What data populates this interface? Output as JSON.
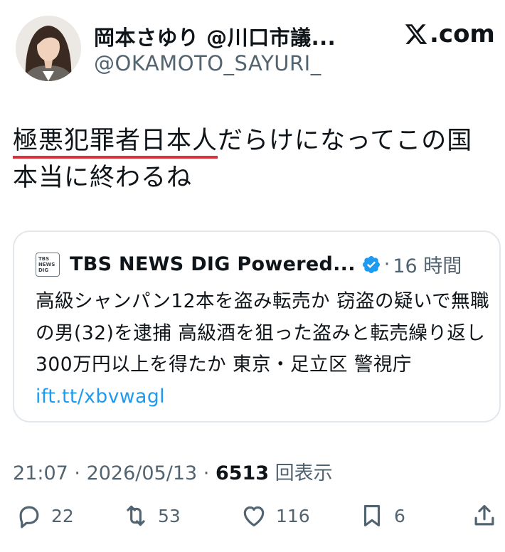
{
  "header": {
    "display_name": "岡本さゆり @川口市議...",
    "handle": "@OKAMOTO_SAYURI_",
    "site_label": ".com"
  },
  "post": {
    "text_underlined": "極悪犯罪者日本人",
    "text_rest": "だらけになってこの国本当に終わるね",
    "underline_color": "#d8323c"
  },
  "quote": {
    "source_logo_lines": [
      "TBS",
      "NEWS",
      "DIG"
    ],
    "source_name": "TBS NEWS DIG Powered...",
    "separator": "·",
    "time": "16 時間",
    "body": "高級シャンパン12本を盗み転売か 窃盗の疑いで無職の男(32)を逮捕 高級酒を狙った盗みと転売繰り返し300万円以上を得たか 東京・足立区 警視庁 ",
    "link": "ift.tt/xbvwagl",
    "link_color": "#1d9bf0"
  },
  "meta": {
    "time": "21:07",
    "sep1": " · ",
    "date": "2026/05/13",
    "sep2": " · ",
    "views_count": "6513",
    "views_label": " 回表示"
  },
  "actions": {
    "replies": "22",
    "reposts": "53",
    "likes": "116",
    "bookmarks": "6"
  },
  "icons": {
    "reply": "reply-icon",
    "repost": "repost-icon",
    "like": "heart-icon",
    "bookmark": "bookmark-icon",
    "share": "share-icon",
    "verified": "verified-badge-icon",
    "logo": "x-logo-icon"
  },
  "colors": {
    "text": "#0f1419",
    "secondary": "#536471",
    "verified": "#1d9bf0"
  }
}
